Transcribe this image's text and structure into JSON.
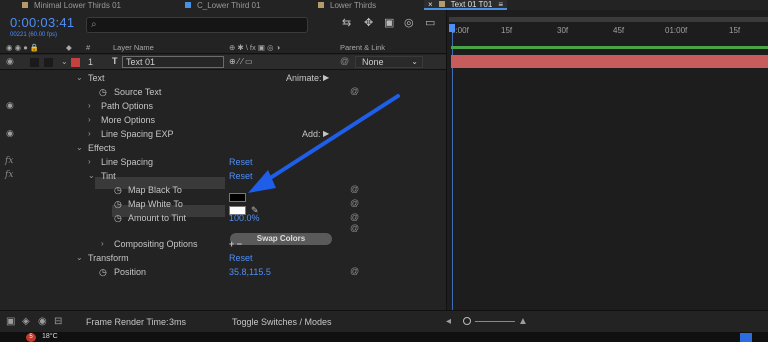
{
  "tabs": [
    {
      "label": "Minimal Lower Thirds 01",
      "color": "#b59a6a"
    },
    {
      "label": "C_Lower Third 01",
      "color": "#4a90e2"
    },
    {
      "label": "Lower Thirds",
      "color": "#b59a6a"
    },
    {
      "label": "Text 01 T01",
      "color": "#b59a6a",
      "active": true
    }
  ],
  "tab_close": "×",
  "tab_menu": "≡",
  "timecode": "0:00:03:41",
  "fps_note": "00221 (60.00 fps)",
  "columns": {
    "hash": "#",
    "layer_name": "Layer Name",
    "switches": "⊕ ✱ \\ fx ▣ ◎ ◑",
    "parent": "Parent & Link"
  },
  "layer": {
    "index": "1",
    "type_icon": "T",
    "name": "Text 01",
    "parent": "None",
    "switches": "⊕ ⁄ ⁄ ▭"
  },
  "rows": {
    "text_group": "Text",
    "animate": "Animate:",
    "source_text": "Source Text",
    "path_options": "Path Options",
    "more_options": "More Options",
    "line_spacing_exp": "Line Spacing EXP",
    "add": "Add:",
    "effects": "Effects",
    "line_spacing": "Line Spacing",
    "tint": "Tint",
    "map_black": "Map Black To",
    "map_white": "Map White To",
    "amount_to_tint": "Amount to Tint",
    "amount_value": "100.0%",
    "swap_colors": "Swap Colors",
    "compositing_options": "Compositing Options",
    "compositing_controls": "+ −",
    "transform": "Transform",
    "position": "Position",
    "position_value": "35.8,115.5",
    "reset": "Reset"
  },
  "ruler_ticks": [
    "0:00f",
    "15f",
    "30f",
    "45f",
    "01:00f",
    "15f"
  ],
  "bottom": {
    "frame_render_label": "Frame Render Time:",
    "frame_render_value": "3ms",
    "toggle": "Toggle Switches / Modes"
  },
  "taskbar": {
    "badge": "5",
    "temperature": "18°C"
  },
  "colors": {
    "accent_blue": "#4f8ef7",
    "layer_label_red": "#c74040",
    "layer_bar": "#c75c5c",
    "work_area_green": "#47a447",
    "annotation_arrow": "#1f5ee8"
  }
}
